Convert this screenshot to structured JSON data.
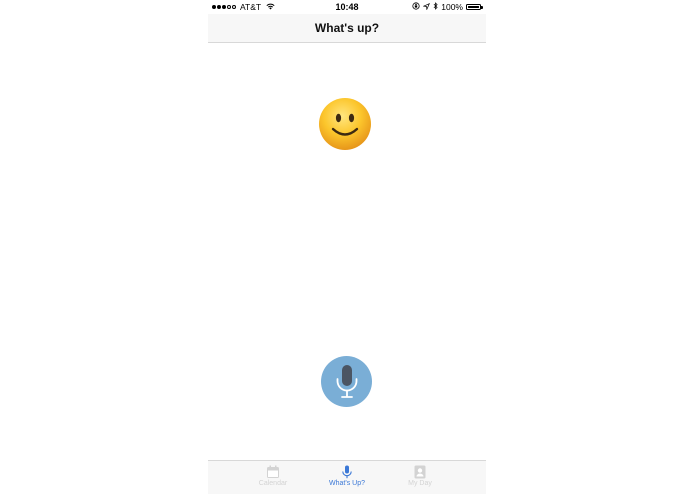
{
  "status_bar": {
    "carrier": "AT&T",
    "signal_bars_filled": 3,
    "signal_bars_total": 5,
    "time": "10:48",
    "battery": "100%",
    "icons": [
      "wifi-icon",
      "orientation-lock-icon",
      "location-icon",
      "bluetooth-icon",
      "battery-icon"
    ]
  },
  "nav": {
    "title": "What's up?"
  },
  "content": {
    "emoji": "slightly-smiling-face",
    "mic_button": "microphone-icon",
    "mic_color": "#7aaed6"
  },
  "tabs": [
    {
      "label": "Calendar",
      "icon": "calendar-icon",
      "active": false
    },
    {
      "label": "What's Up?",
      "icon": "microphone-icon",
      "active": true
    },
    {
      "label": "My Day",
      "icon": "contact-card-icon",
      "active": false
    }
  ],
  "colors": {
    "tab_active": "#3b78d6",
    "tab_inactive": "#d3d3d3",
    "bar_background": "#f7f7f7"
  }
}
